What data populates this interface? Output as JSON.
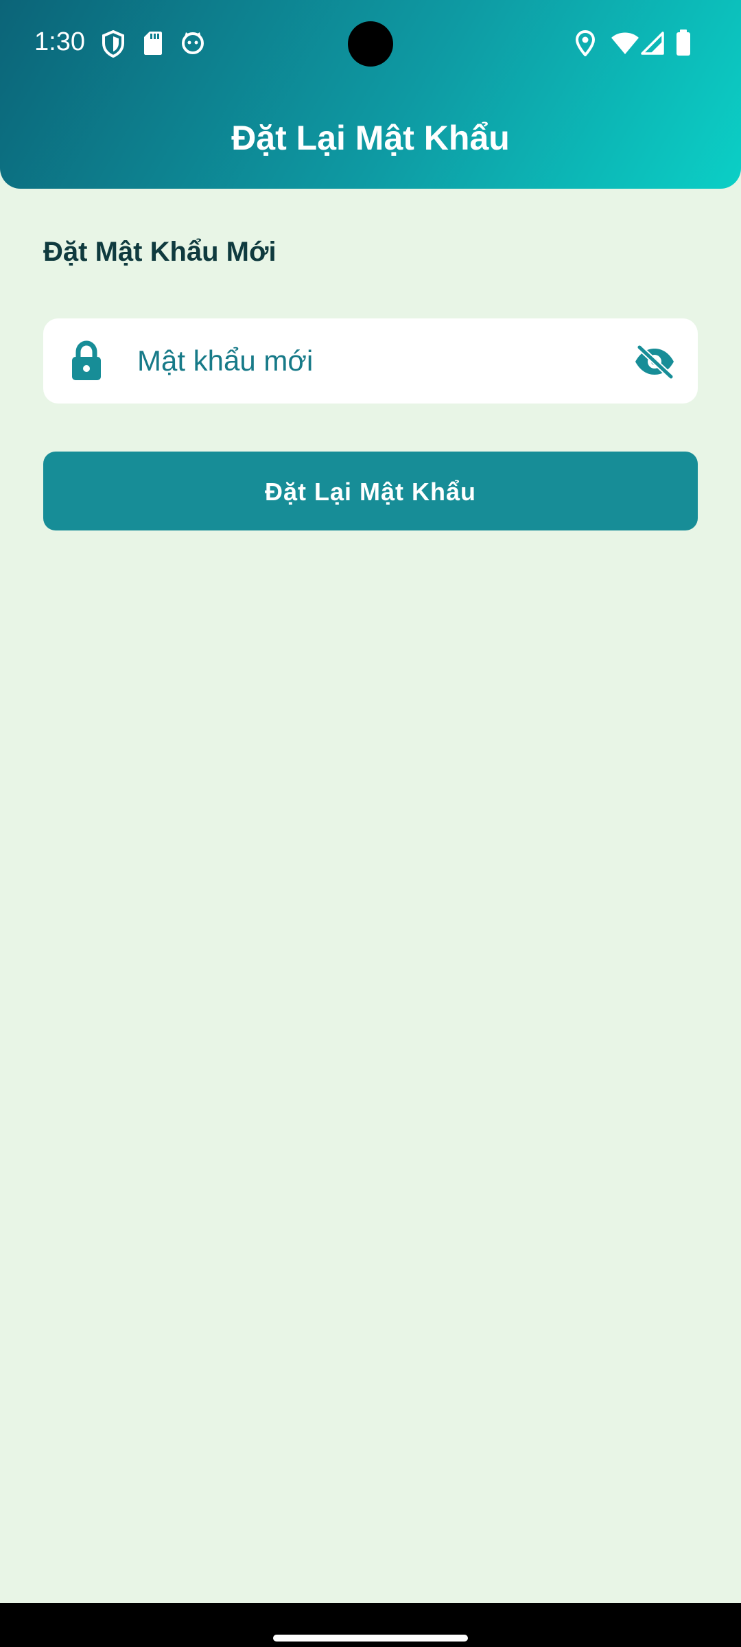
{
  "status_bar": {
    "time": "1:30",
    "icons": [
      "shield-icon",
      "sd-card-icon",
      "cat-face-icon",
      "location-icon",
      "wifi-icon",
      "signal-icon",
      "battery-icon"
    ]
  },
  "header": {
    "title": "Đặt Lại Mật Khẩu"
  },
  "form": {
    "section_title": "Đặt Mật Khẩu Mới",
    "password_placeholder": "Mật khẩu mới",
    "password_value": "",
    "submit_label": "Đặt Lại Mật Khẩu"
  },
  "colors": {
    "background": "#e8f5e6",
    "accent": "#178d97",
    "header_gradient_start": "#0c6478",
    "header_gradient_end": "#0bcfc6"
  }
}
